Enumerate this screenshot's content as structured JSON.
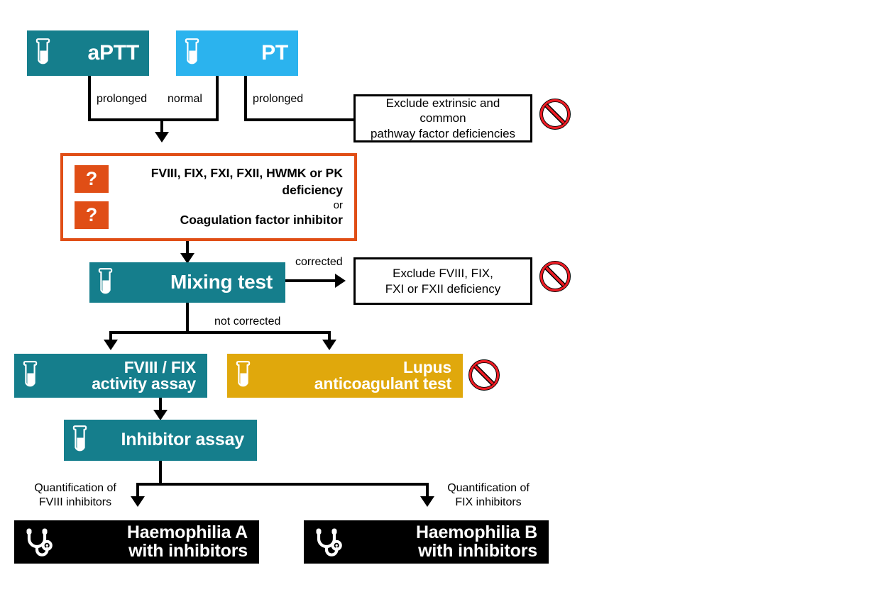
{
  "diagram": {
    "title": "aPTT / PT coagulation diagnostic algorithm",
    "colors": {
      "teal": "#157E8C",
      "light_blue": "#2BB3EE",
      "amber": "#E0A80C",
      "orange": "#E04E16",
      "black": "#000000",
      "ban_red": "#ED1C24",
      "white": "#FFFFFF"
    }
  },
  "nodes": {
    "aptt": {
      "label": "aPTT",
      "icon": "test-tube-icon",
      "color": "#157E8C"
    },
    "pt": {
      "label": "PT",
      "icon": "test-tube-icon",
      "color": "#2BB3EE"
    },
    "exclude_extrinsic": {
      "label": "Exclude extrinsic and common\npathway factor deficiencies"
    },
    "uncertain": {
      "line1": "FVIII, FIX, FXI, FXII, HWMK or PK deficiency",
      "line2": "or",
      "line3": "Coagulation factor inhibitor",
      "marker1": "?",
      "marker2": "?"
    },
    "mixing_test": {
      "label": "Mixing test",
      "icon": "test-tube-icon",
      "color": "#157E8C"
    },
    "exclude_intrinsic": {
      "label": "Exclude FVIII, FIX,\nFXI or FXII deficiency"
    },
    "activity_assay": {
      "label": "FVIII / FIX\nactivity assay",
      "icon": "test-tube-icon",
      "color": "#157E8C"
    },
    "lupus_test": {
      "label": "Lupus\nanticoagulant test",
      "icon": "test-tube-icon",
      "color": "#E0A80C"
    },
    "inhibitor_assay": {
      "label": "Inhibitor assay",
      "icon": "test-tube-icon",
      "color": "#157E8C"
    },
    "haemophilia_a": {
      "label": "Haemophilia A\nwith inhibitors",
      "icon": "stethoscope-icon",
      "color": "#000000"
    },
    "haemophilia_b": {
      "label": "Haemophilia B\nwith inhibitors",
      "icon": "stethoscope-icon",
      "color": "#000000"
    }
  },
  "edge_labels": {
    "aptt_prolonged": "prolonged",
    "pt_normal": "normal",
    "pt_prolonged": "prolonged",
    "corrected": "corrected",
    "not_corrected": "not corrected",
    "quant_fviii": "Quantification of\nFVIII inhibitors",
    "quant_fix": "Quantification of\nFIX inhibitors"
  },
  "markers": {
    "ban_icon_name": "prohibition-icon",
    "ban_count": 3
  }
}
